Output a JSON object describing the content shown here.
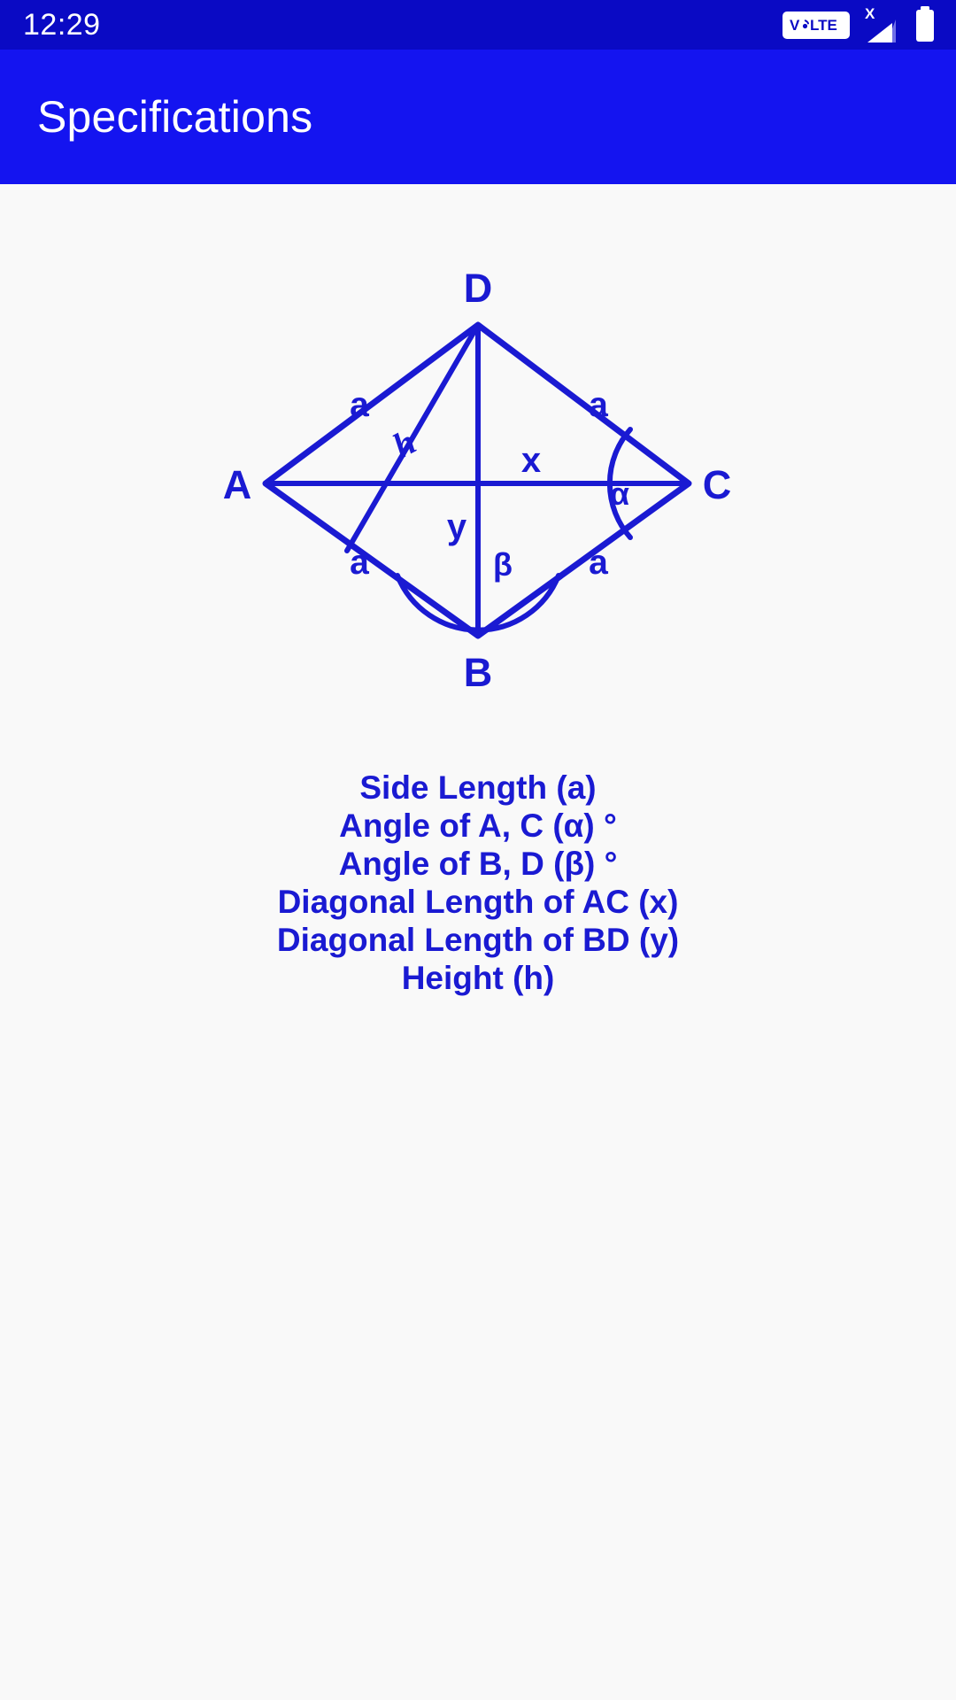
{
  "status_bar": {
    "time": "12:29",
    "volte_label": "VoLTE",
    "signal_badge": "X",
    "icons": [
      "volte-icon",
      "signal-bars-icon",
      "battery-icon"
    ]
  },
  "app_bar": {
    "title": "Specifications",
    "background_color": "#1414f0",
    "text_color": "#ffffff"
  },
  "theme": {
    "accent_blue": "#1a1ad2",
    "diagram_stroke": "#1a1ad2",
    "content_background": "#f9f9f9",
    "status_bar_color": "#0a0ac4"
  },
  "diagram": {
    "name": "rhombus-diagram",
    "shape": "rhombus",
    "vertex_labels": {
      "A": "A",
      "B": "B",
      "C": "C",
      "D": "D"
    },
    "side_labels": [
      "a",
      "a",
      "a",
      "a"
    ],
    "diagonal_labels": {
      "AC": "x",
      "BD": "y"
    },
    "angle_labels": {
      "at_C": "α",
      "at_B": "β"
    },
    "height_label": "h"
  },
  "specifications": {
    "items": [
      {
        "label": "Side Length (a)"
      },
      {
        "label": "Angle of A, C (α) °"
      },
      {
        "label": "Angle of B, D (β) °"
      },
      {
        "label": "Diagonal Length of AC (x)"
      },
      {
        "label": "Diagonal Length of BD (y)"
      },
      {
        "label": "Height (h)"
      }
    ]
  }
}
